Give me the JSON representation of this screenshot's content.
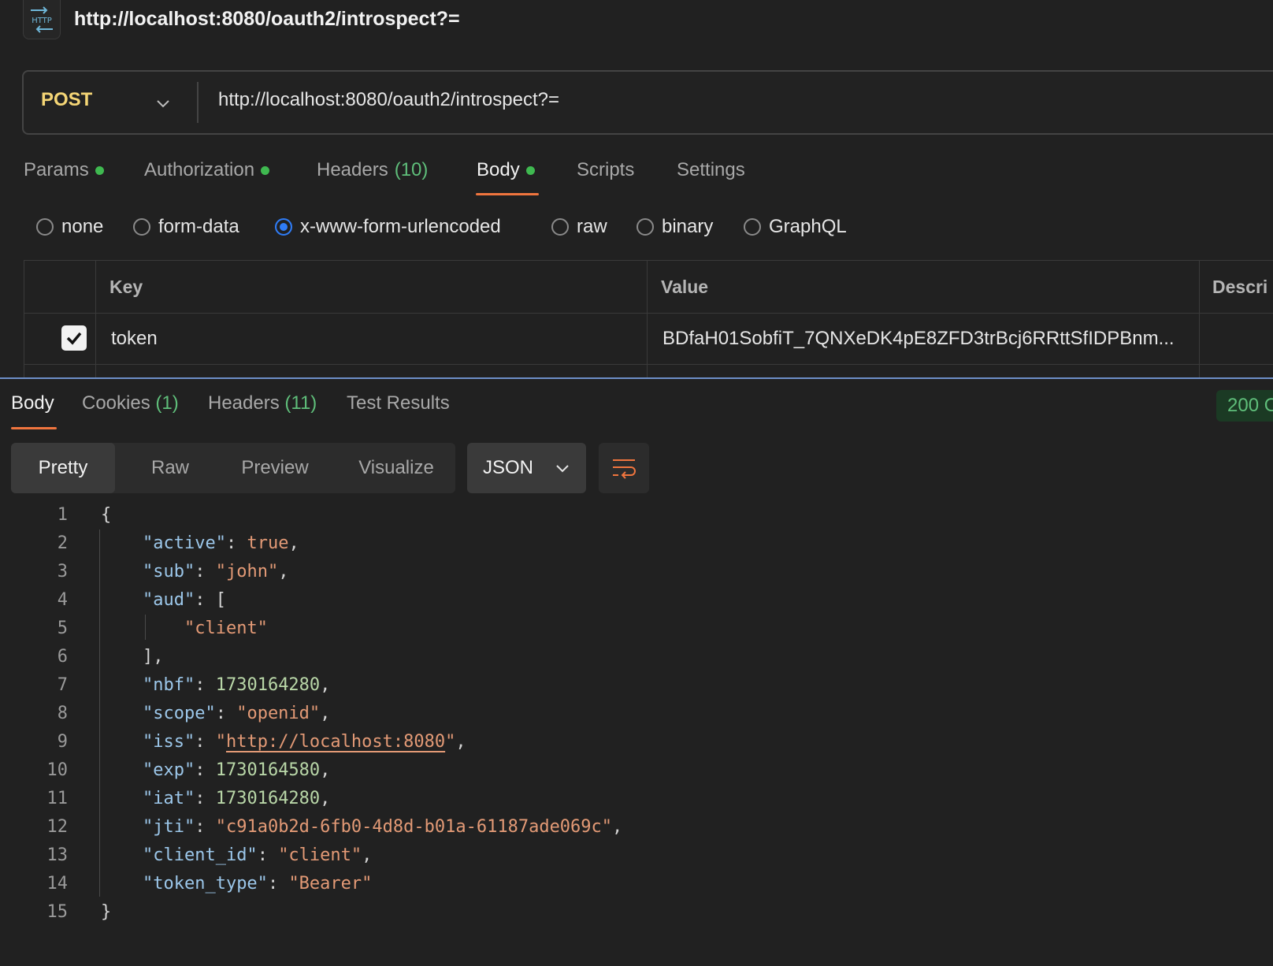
{
  "header": {
    "badge": "HTTP",
    "title": "http://localhost:8080/oauth2/introspect?="
  },
  "request": {
    "method": "POST",
    "url": "http://localhost:8080/oauth2/introspect?="
  },
  "tabs": [
    {
      "label": "Params",
      "count": "",
      "dot": true
    },
    {
      "label": "Authorization",
      "count": "",
      "dot": true
    },
    {
      "label": "Headers",
      "count": "(10)",
      "dot": false
    },
    {
      "label": "Body",
      "count": "",
      "dot": true
    },
    {
      "label": "Scripts",
      "count": "",
      "dot": false
    },
    {
      "label": "Settings",
      "count": "",
      "dot": false
    }
  ],
  "body_types": [
    "none",
    "form-data",
    "x-www-form-urlencoded",
    "raw",
    "binary",
    "GraphQL"
  ],
  "body_type_selected": "x-www-form-urlencoded",
  "table": {
    "headers": [
      "Key",
      "Value",
      "Descri"
    ],
    "rows": [
      {
        "checked": true,
        "key": "token",
        "value": "BDfaH01SobfiT_7QNXeDK4pE8ZFD3trBcj6RRttSfIDPBnm..."
      }
    ]
  },
  "response": {
    "tabs": [
      {
        "label": "Body",
        "count": ""
      },
      {
        "label": "Cookies",
        "count": "(1)"
      },
      {
        "label": "Headers",
        "count": "(11)"
      },
      {
        "label": "Test Results",
        "count": ""
      }
    ],
    "status": "200 O",
    "views": [
      "Pretty",
      "Raw",
      "Preview",
      "Visualize"
    ],
    "format": "JSON",
    "lines": [
      [
        [
          "p",
          "{"
        ]
      ],
      [
        [
          "p",
          "    "
        ],
        [
          "k",
          "\"active\""
        ],
        [
          "p",
          ": "
        ],
        [
          "b",
          "true"
        ],
        [
          "p",
          ","
        ]
      ],
      [
        [
          "p",
          "    "
        ],
        [
          "k",
          "\"sub\""
        ],
        [
          "p",
          ": "
        ],
        [
          "s",
          "\"john\""
        ],
        [
          "p",
          ","
        ]
      ],
      [
        [
          "p",
          "    "
        ],
        [
          "k",
          "\"aud\""
        ],
        [
          "p",
          ": ["
        ]
      ],
      [
        [
          "p",
          "        "
        ],
        [
          "s",
          "\"client\""
        ]
      ],
      [
        [
          "p",
          "    ],"
        ]
      ],
      [
        [
          "p",
          "    "
        ],
        [
          "k",
          "\"nbf\""
        ],
        [
          "p",
          ": "
        ],
        [
          "n",
          "1730164280"
        ],
        [
          "p",
          ","
        ]
      ],
      [
        [
          "p",
          "    "
        ],
        [
          "k",
          "\"scope\""
        ],
        [
          "p",
          ": "
        ],
        [
          "s",
          "\"openid\""
        ],
        [
          "p",
          ","
        ]
      ],
      [
        [
          "p",
          "    "
        ],
        [
          "k",
          "\"iss\""
        ],
        [
          "p",
          ": "
        ],
        [
          "s",
          "\""
        ],
        [
          "u",
          "http://localhost:8080"
        ],
        [
          "s",
          "\""
        ],
        [
          "p",
          ","
        ]
      ],
      [
        [
          "p",
          "    "
        ],
        [
          "k",
          "\"exp\""
        ],
        [
          "p",
          ": "
        ],
        [
          "n",
          "1730164580"
        ],
        [
          "p",
          ","
        ]
      ],
      [
        [
          "p",
          "    "
        ],
        [
          "k",
          "\"iat\""
        ],
        [
          "p",
          ": "
        ],
        [
          "n",
          "1730164280"
        ],
        [
          "p",
          ","
        ]
      ],
      [
        [
          "p",
          "    "
        ],
        [
          "k",
          "\"jti\""
        ],
        [
          "p",
          ": "
        ],
        [
          "s",
          "\"c91a0b2d-6fb0-4d8d-b01a-61187ade069c\""
        ],
        [
          "p",
          ","
        ]
      ],
      [
        [
          "p",
          "    "
        ],
        [
          "k",
          "\"client_id\""
        ],
        [
          "p",
          ": "
        ],
        [
          "s",
          "\"client\""
        ],
        [
          "p",
          ","
        ]
      ],
      [
        [
          "p",
          "    "
        ],
        [
          "k",
          "\"token_type\""
        ],
        [
          "p",
          ": "
        ],
        [
          "s",
          "\"Bearer\""
        ]
      ],
      [
        [
          "p",
          "}"
        ]
      ]
    ]
  },
  "colors": {
    "accent": "#f0753e",
    "green": "#3fb950",
    "method": "#f5d676",
    "radio_on": "#2f7cf6"
  }
}
